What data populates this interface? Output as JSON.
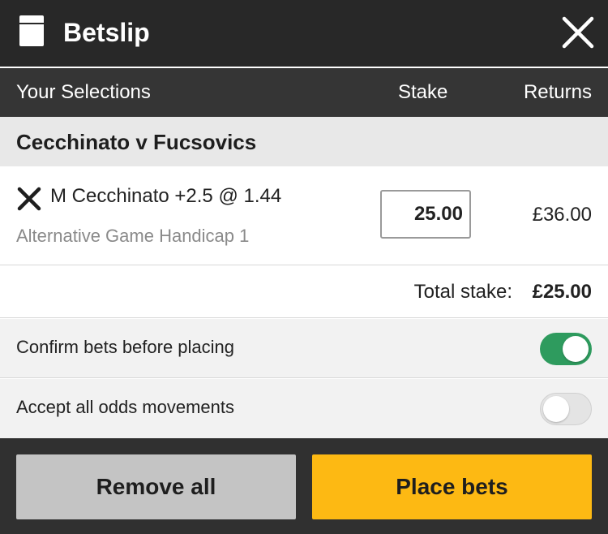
{
  "header": {
    "title": "Betslip",
    "icons": {
      "betslip": "betslip-icon",
      "close": "close-icon"
    }
  },
  "columns": {
    "selections": "Your Selections",
    "stake": "Stake",
    "returns": "Returns"
  },
  "event": {
    "name": "Cecchinato v Fucsovics"
  },
  "selection": {
    "name": "M Cecchinato +2.5 @ 1.44",
    "market": "Alternative Game Handicap 1",
    "stake": "25.00",
    "returns": "£36.00"
  },
  "total": {
    "label": "Total stake:",
    "value": "£25.00"
  },
  "options": [
    {
      "label": "Confirm bets before placing",
      "enabled": true
    },
    {
      "label": "Accept all odds movements",
      "enabled": false
    }
  ],
  "footer": {
    "remove_all": "Remove all",
    "place_bets": "Place bets"
  },
  "colors": {
    "titlebar": "#282828",
    "toggle_on": "#2e9b5e",
    "place_button": "#fdb913",
    "remove_button": "#c4c4c4"
  }
}
